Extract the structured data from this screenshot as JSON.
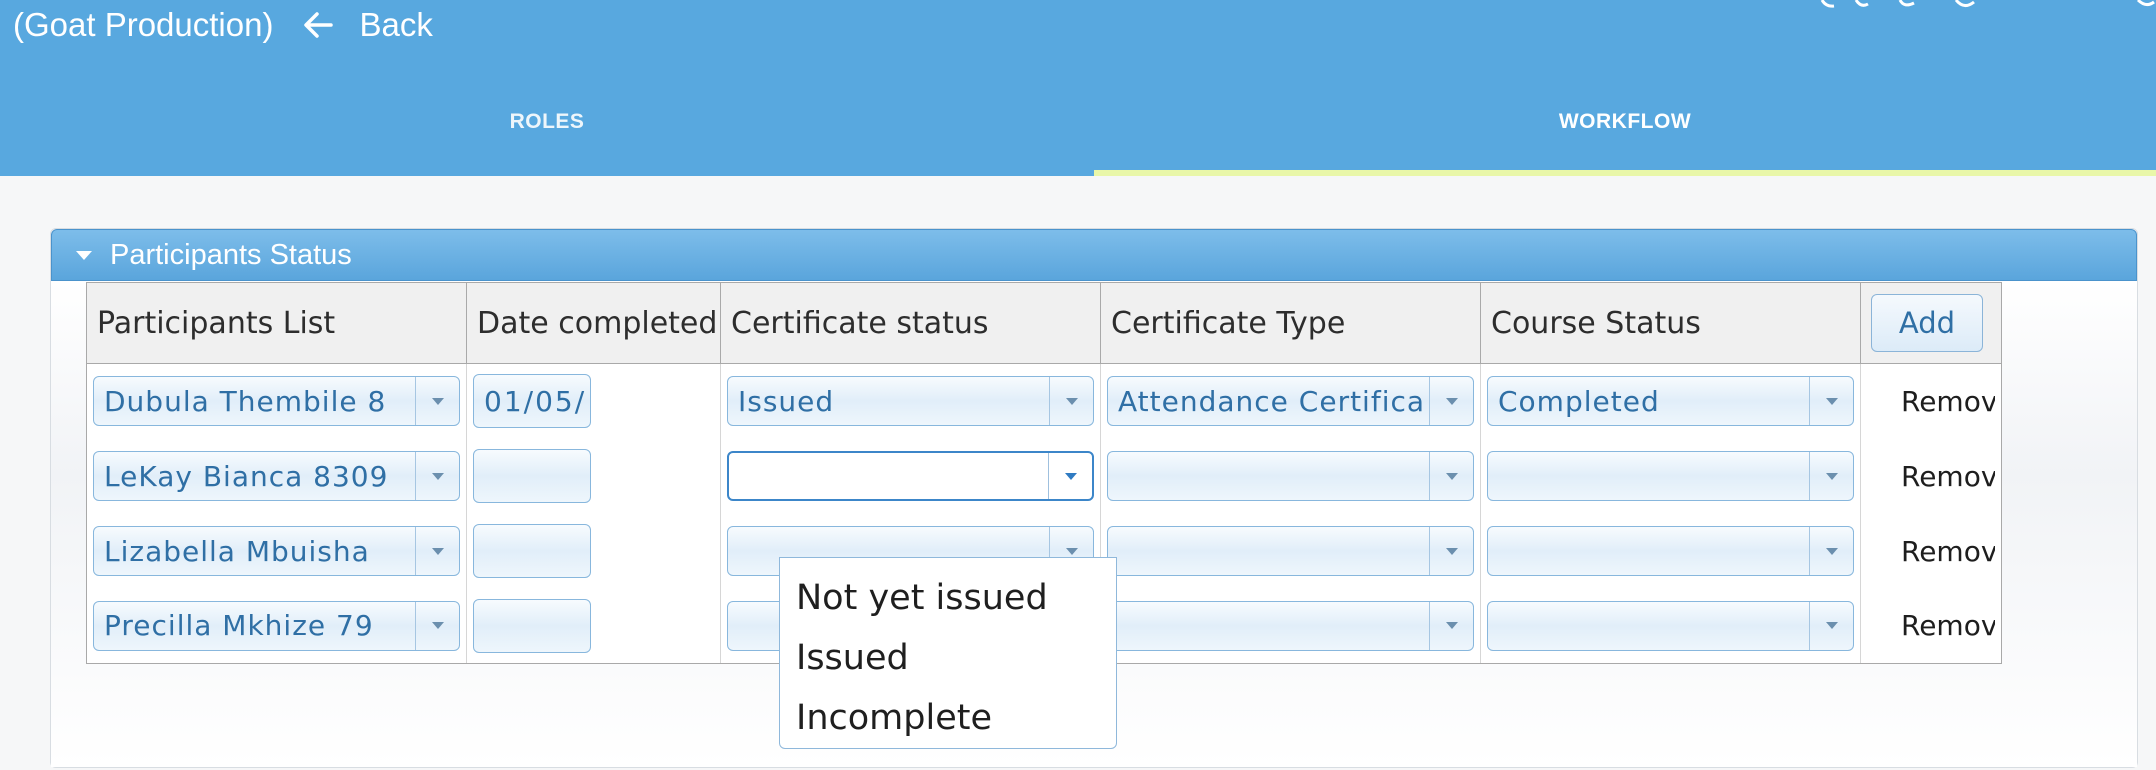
{
  "header": {
    "title": "(Goat Production)",
    "back_label": "Back"
  },
  "tabs": [
    {
      "label": "ROLES",
      "active": false
    },
    {
      "label": "WORKFLOW",
      "active": true
    }
  ],
  "panel": {
    "title": "Participants Status"
  },
  "table": {
    "columns": [
      "Participants List",
      "Date completed",
      "Certificate status",
      "Certificate Type",
      "Course Status"
    ],
    "add_label": "Add",
    "rows": [
      {
        "participant": "Dubula Thembile 8",
        "date": "01/05/",
        "certificate_status": "Issued",
        "certificate_type": "Attendance Certifica",
        "course_status": "Completed",
        "remove_label": "Remove"
      },
      {
        "participant": "LeKay Bianca 8309",
        "date": "",
        "certificate_status": "",
        "certificate_type": "",
        "course_status": "",
        "remove_label": "Remove"
      },
      {
        "participant": "Lizabella Mbuisha",
        "date": "",
        "certificate_status": "",
        "certificate_type": "",
        "course_status": "",
        "remove_label": "Remove"
      },
      {
        "participant": "Precilla Mkhize 79",
        "date": "",
        "certificate_status": "",
        "certificate_type": "",
        "course_status": "",
        "remove_label": "Remove"
      }
    ]
  },
  "dropdown": {
    "options": [
      "Not yet issued",
      "Issued",
      "Incomplete"
    ]
  },
  "colors": {
    "topbar": "#58a8df",
    "tab_underline": "#e9f7a9",
    "panel_header": "#5aa5dc",
    "combo_text": "#2f6fa5"
  },
  "icons": {
    "back": "arrow-left-icon",
    "panel_toggle": "caret-down-icon",
    "combo": "chevron-down-icon"
  }
}
